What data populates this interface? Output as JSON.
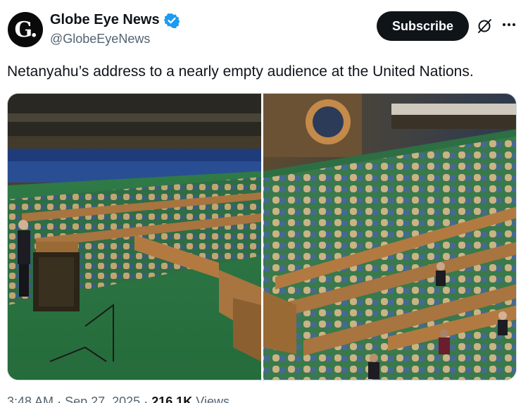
{
  "author": {
    "avatar_letter": "G.",
    "display_name": "Globe Eye News",
    "handle": "@GlobeEyeNews",
    "verified_color": "#1d9bf0"
  },
  "actions": {
    "subscribe_label": "Subscribe",
    "grok_icon": "grok-icon",
    "more_icon": "more-icon"
  },
  "tweet": {
    "text": "Netanyahu’s address to a nearly empty audience at the United Nations."
  },
  "media": {
    "panels": 2,
    "description_icon": "photo"
  },
  "meta": {
    "time": "3:48 AM",
    "separator": "·",
    "date": "Sep 27, 2025",
    "views_count": "216.1K",
    "views_label": "Views"
  }
}
